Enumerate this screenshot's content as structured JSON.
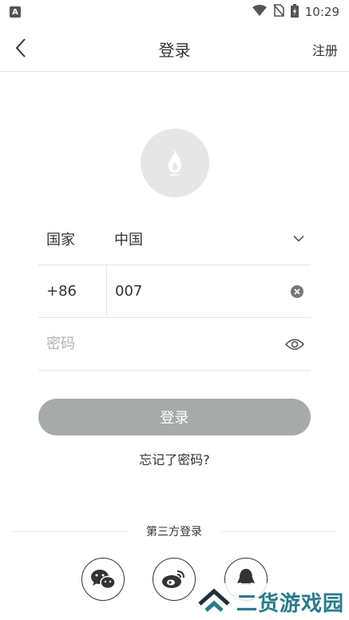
{
  "status_bar": {
    "app_indicator": "A",
    "time": "10:29"
  },
  "nav": {
    "title": "登录",
    "register": "注册"
  },
  "form": {
    "country_label": "国家",
    "country_value": "中国",
    "phone_code": "+86",
    "phone_value": "007",
    "password_placeholder": "密码"
  },
  "actions": {
    "login": "登录",
    "forgot_password": "忘记了密码?"
  },
  "third_party": {
    "label": "第三方登录",
    "providers": [
      "wechat",
      "weibo",
      "qq"
    ]
  },
  "watermark": {
    "text": "二货游戏园"
  },
  "colors": {
    "login_button": "#a6aaa8",
    "divider": "#e6e6e6",
    "watermark": "#2a7a8c"
  }
}
